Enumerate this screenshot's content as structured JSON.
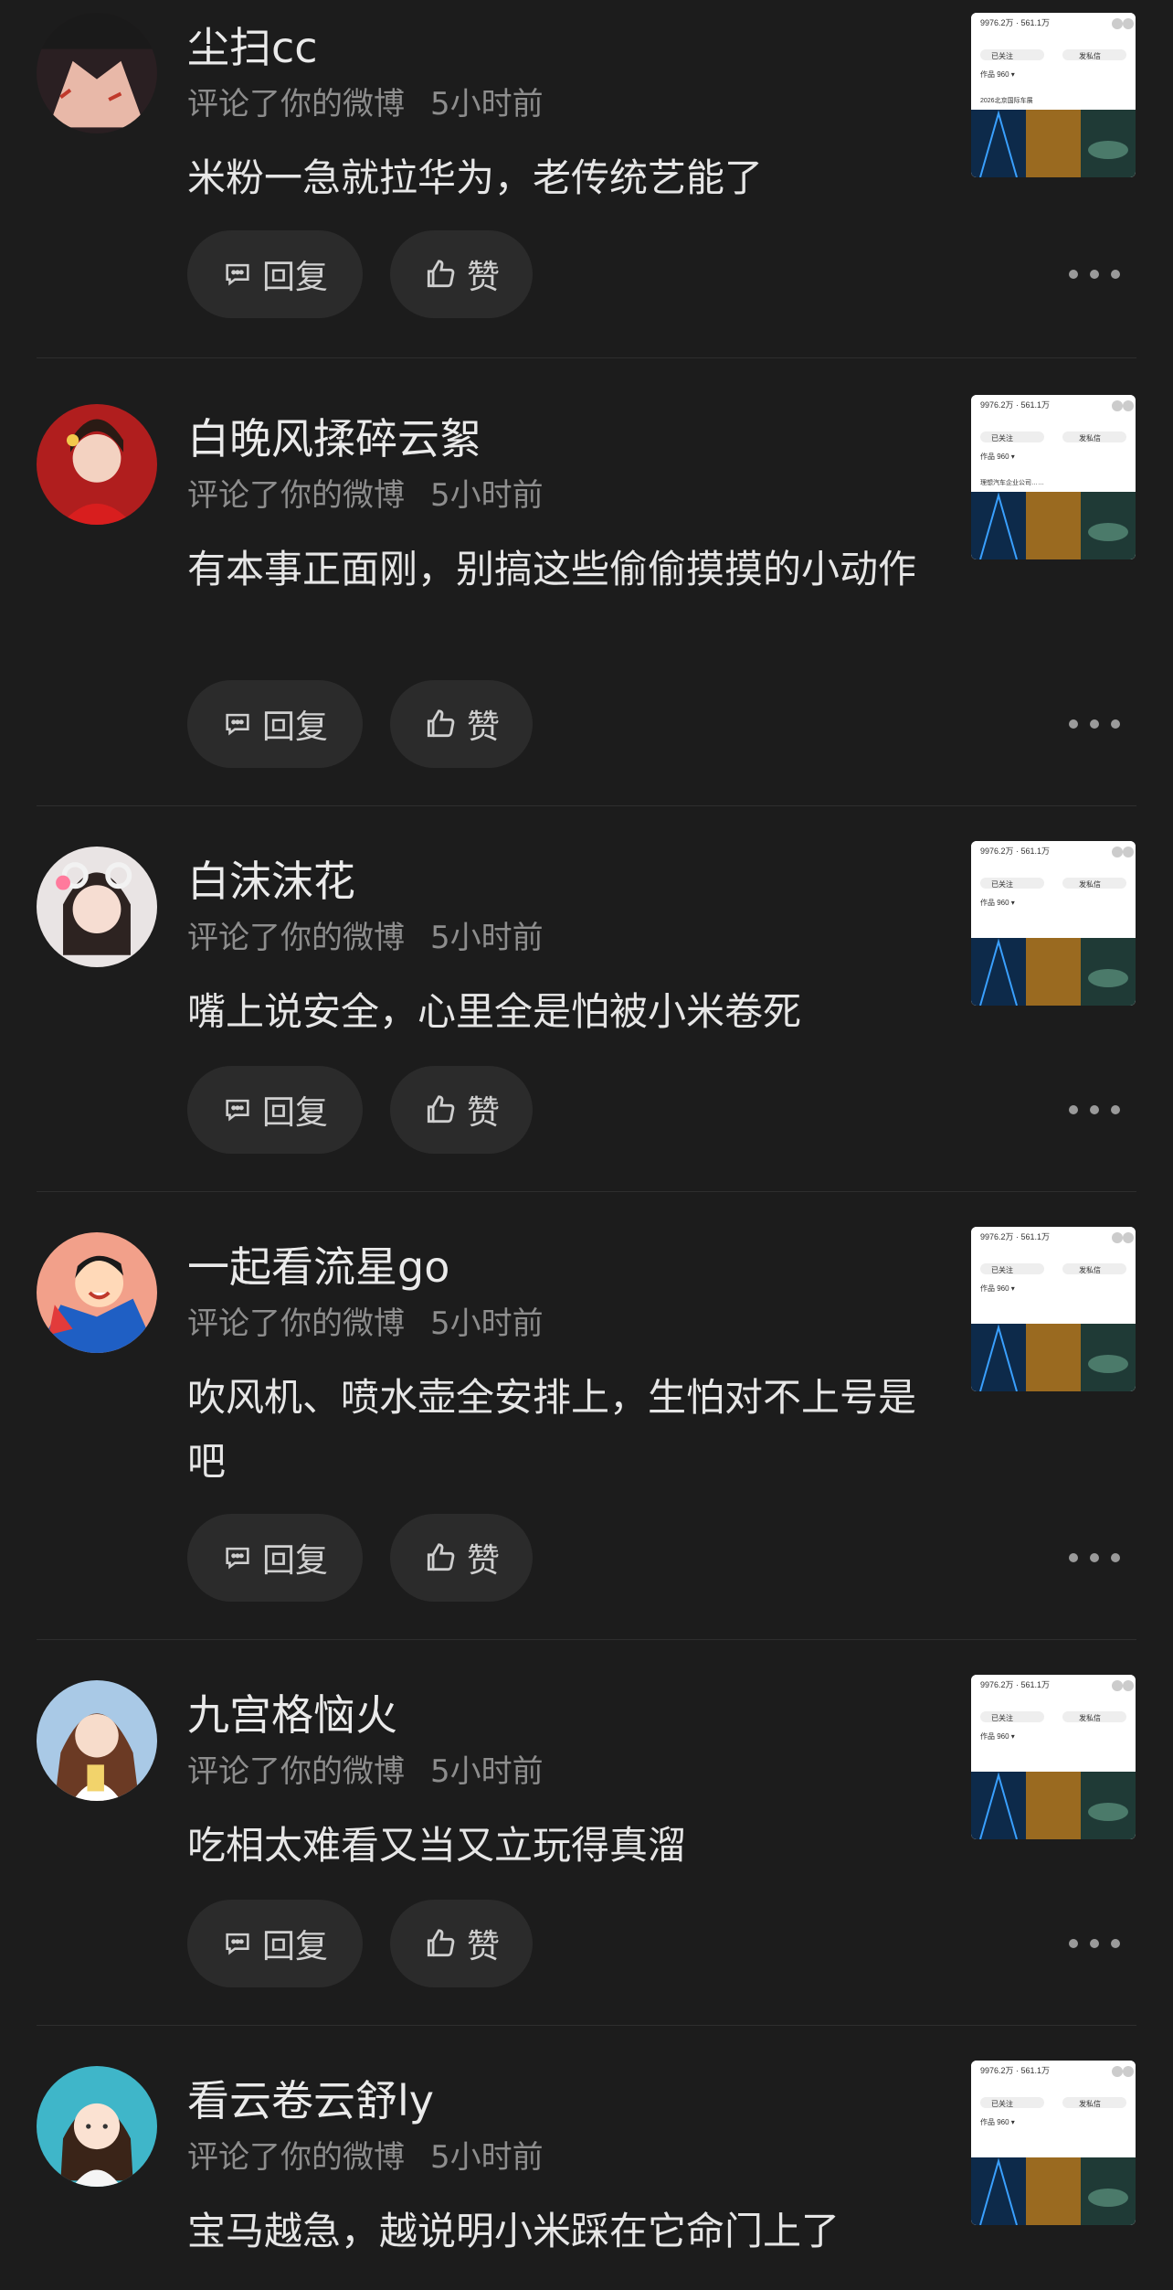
{
  "labels": {
    "reply": "回复",
    "like": "赞"
  },
  "comments": [
    {
      "name": "尘扫cc",
      "action": "评论了你的微博",
      "time": "5小时前",
      "text": "米粉一急就拉华为，老传统艺能了",
      "avatar": "hands-avatar"
    },
    {
      "name": "白晚风揉碎云絮",
      "action": "评论了你的微博",
      "time": "5小时前",
      "text": "有本事正面刚，别搞这些偷偷摸摸的小动作",
      "avatar": "woman-red-dress-avatar"
    },
    {
      "name": "白沫沫花",
      "action": "评论了你的微博",
      "time": "5小时前",
      "text": "嘴上说安全，心里全是怕被小米卷死",
      "avatar": "girl-hat-avatar"
    },
    {
      "name": "一起看流星go",
      "action": "评论了你的微博",
      "time": "5小时前",
      "text": "吹风机、喷水壶全安排上，生怕对不上号是吧",
      "avatar": "cartoon-hero-avatar"
    },
    {
      "name": "九宫格恼火",
      "action": "评论了你的微博",
      "time": "5小时前",
      "text": "吃相太难看又当又立玩得真溜",
      "avatar": "girl-selfie-avatar"
    },
    {
      "name": "看云卷云舒ly",
      "action": "评论了你的微博",
      "time": "5小时前",
      "text": "宝马越急，越说明小米踩在它命门上了",
      "avatar": "cartoon-girl-avatar"
    }
  ],
  "thumbnail": {
    "stats": "9976.2万 · 561.1万",
    "tabs": [
      "已关注",
      "发私信"
    ],
    "row_label": "作品 960 ▾",
    "links": [
      "2026北京国际车展",
      "理想汽车企业公司……"
    ]
  },
  "colors": {
    "background": "#1c1c1c",
    "button": "#2b2b2b",
    "meta": "#8d8d8d"
  },
  "icons": {
    "reply": "comment-icon",
    "like": "thumb-up-icon",
    "more": "more-dots-icon"
  }
}
